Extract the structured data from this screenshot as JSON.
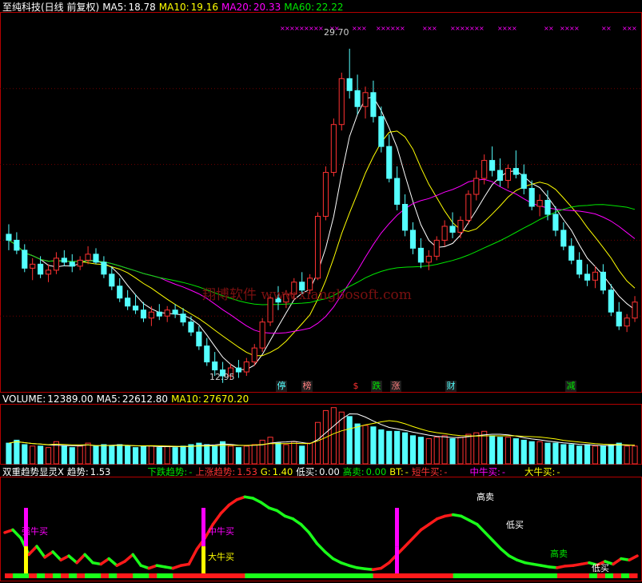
{
  "header": {
    "stock": "至纯科技(日线 前复权)",
    "ma5_label": "MA5:",
    "ma5_value": "18.78",
    "ma10_label": "MA10:",
    "ma10_value": "19.16",
    "ma20_label": "MA20:",
    "ma20_value": "20.33",
    "ma60_label": "MA60:",
    "ma60_value": "22.22"
  },
  "colors": {
    "up": "#ff3232",
    "down": "#54ffff",
    "ma5": "#ffffff",
    "ma10": "#ffff00",
    "ma20": "#ff00ff",
    "ma60": "#00e600",
    "panel_border": "#b40000",
    "grid": "#700000"
  },
  "annotations": {
    "high_label": "29.70",
    "low_label": "12.95",
    "watermark": "翔博软件 www.xiangbosoft.com"
  },
  "event_badges": [
    {
      "text": "停",
      "color": "#54ffff"
    },
    {
      "text": "榜",
      "color": "#ff8080"
    },
    {
      "text": "$",
      "color": "#ff3232"
    },
    {
      "text": "跌",
      "color": "#00e600"
    },
    {
      "text": "涨",
      "color": "#ff8080"
    },
    {
      "text": "财",
      "color": "#54ffff"
    },
    {
      "text": "减",
      "color": "#00e600"
    }
  ],
  "volume_header": {
    "label": "VOLUME:",
    "value": "12389.00",
    "ma5_label": "MA5:",
    "ma5_value": "22612.80",
    "ma10_label": "MA10:",
    "ma10_value": "27670.20"
  },
  "indicator_header": {
    "name": "双重趋势显灵X",
    "trend_label": "趋势:",
    "trend_value": "1.53",
    "down_label": "下跌趋势:",
    "down_value": "-",
    "up_label": "上涨趋势:",
    "up_value": "1.53",
    "g_label": "G:",
    "g_value": "1.40",
    "lowbuy_label": "低买:",
    "lowbuy_value": "0.00",
    "highsell_label": "高卖:",
    "highsell_value": "0.00",
    "bt_label": "BT:",
    "bt_value": "-",
    "short_bull_label": "短牛买:",
    "short_bull_value": "-",
    "mid_bull_label": "中牛买:",
    "mid_bull_value": "-",
    "big_bull_label": "大牛买:",
    "big_bull_value": "-"
  },
  "signal_labels": [
    {
      "text": "高卖",
      "color": "#ffffff"
    },
    {
      "text": "低买",
      "color": "#ffffff"
    },
    {
      "text": "中牛买",
      "color": "#ff00ff"
    },
    {
      "text": "大牛买",
      "color": "#ffff00"
    },
    {
      "text": "强牛买",
      "color": "#ff00ff"
    },
    {
      "text": "高卖",
      "color": "#00e600"
    },
    {
      "text": "低买",
      "color": "#ffffff"
    }
  ],
  "chart_data": {
    "type": "candlestick",
    "candles": [
      [
        20.4,
        20.9,
        19.6,
        20.1
      ],
      [
        20.1,
        20.5,
        19.4,
        19.6
      ],
      [
        19.6,
        19.9,
        18.5,
        18.7
      ],
      [
        18.7,
        19.2,
        18.1,
        18.9
      ],
      [
        18.9,
        19.3,
        18.2,
        18.4
      ],
      [
        18.4,
        18.9,
        18.0,
        18.6
      ],
      [
        18.6,
        19.5,
        18.4,
        19.2
      ],
      [
        19.2,
        19.6,
        18.8,
        19.0
      ],
      [
        19.0,
        19.4,
        18.5,
        18.8
      ],
      [
        18.8,
        19.3,
        18.6,
        19.1
      ],
      [
        19.1,
        19.8,
        18.9,
        19.4
      ],
      [
        19.4,
        19.7,
        18.9,
        19.0
      ],
      [
        19.0,
        19.3,
        18.2,
        18.4
      ],
      [
        18.4,
        18.8,
        17.6,
        17.8
      ],
      [
        17.8,
        18.2,
        17.0,
        17.2
      ],
      [
        17.2,
        17.6,
        16.6,
        16.8
      ],
      [
        16.8,
        17.4,
        16.4,
        16.6
      ],
      [
        16.6,
        17.0,
        16.0,
        16.2
      ],
      [
        16.2,
        16.8,
        15.8,
        16.5
      ],
      [
        16.5,
        16.9,
        16.1,
        16.3
      ],
      [
        16.3,
        16.8,
        16.0,
        16.6
      ],
      [
        16.6,
        16.9,
        16.2,
        16.4
      ],
      [
        16.4,
        16.7,
        15.8,
        16.0
      ],
      [
        16.0,
        16.3,
        15.3,
        15.5
      ],
      [
        15.5,
        15.8,
        14.6,
        14.8
      ],
      [
        14.8,
        15.2,
        13.8,
        14.0
      ],
      [
        14.0,
        14.5,
        13.3,
        13.6
      ],
      [
        13.6,
        14.0,
        12.95,
        13.3
      ],
      [
        13.3,
        13.9,
        13.1,
        13.7
      ],
      [
        13.7,
        14.1,
        13.2,
        13.5
      ],
      [
        13.5,
        14.2,
        13.3,
        14.0
      ],
      [
        14.0,
        14.9,
        13.8,
        14.7
      ],
      [
        14.7,
        16.2,
        14.5,
        16.0
      ],
      [
        16.0,
        17.4,
        15.8,
        17.2
      ],
      [
        17.2,
        17.8,
        16.6,
        17.0
      ],
      [
        17.0,
        17.6,
        16.7,
        17.4
      ],
      [
        17.4,
        18.2,
        17.1,
        18.0
      ],
      [
        18.0,
        18.5,
        17.4,
        17.6
      ],
      [
        17.6,
        18.4,
        17.4,
        18.2
      ],
      [
        18.2,
        21.5,
        18.1,
        21.3
      ],
      [
        21.3,
        23.8,
        21.1,
        23.5
      ],
      [
        23.5,
        26.2,
        23.3,
        25.9
      ],
      [
        25.9,
        28.5,
        25.6,
        28.2
      ],
      [
        28.2,
        29.7,
        27.2,
        27.6
      ],
      [
        27.6,
        28.4,
        26.4,
        26.8
      ],
      [
        26.8,
        27.8,
        26.2,
        27.5
      ],
      [
        27.5,
        28.1,
        26.0,
        26.3
      ],
      [
        26.3,
        26.8,
        24.5,
        24.8
      ],
      [
        24.8,
        25.4,
        23.0,
        23.2
      ],
      [
        23.2,
        23.8,
        21.6,
        21.9
      ],
      [
        21.9,
        22.4,
        20.3,
        20.6
      ],
      [
        20.6,
        21.0,
        19.4,
        19.7
      ],
      [
        19.7,
        20.2,
        18.7,
        19.0
      ],
      [
        19.0,
        19.6,
        18.6,
        19.3
      ],
      [
        19.3,
        20.3,
        19.1,
        20.1
      ],
      [
        20.1,
        21.1,
        19.8,
        20.8
      ],
      [
        20.8,
        21.5,
        20.2,
        20.5
      ],
      [
        20.5,
        21.3,
        20.2,
        21.1
      ],
      [
        21.1,
        22.6,
        20.9,
        22.4
      ],
      [
        22.4,
        23.6,
        22.1,
        23.2
      ],
      [
        23.2,
        24.4,
        22.9,
        24.1
      ],
      [
        24.1,
        24.8,
        23.3,
        23.6
      ],
      [
        23.6,
        24.2,
        22.8,
        23.1
      ],
      [
        23.1,
        23.9,
        22.7,
        23.7
      ],
      [
        23.7,
        24.6,
        23.2,
        23.4
      ],
      [
        23.4,
        23.9,
        22.4,
        22.7
      ],
      [
        22.7,
        23.1,
        21.6,
        21.8
      ],
      [
        21.8,
        22.4,
        21.3,
        22.1
      ],
      [
        22.1,
        22.6,
        21.1,
        21.4
      ],
      [
        21.4,
        21.8,
        20.3,
        20.6
      ],
      [
        20.6,
        21.0,
        19.6,
        19.8
      ],
      [
        19.8,
        20.2,
        18.9,
        19.1
      ],
      [
        19.1,
        19.5,
        18.2,
        18.4
      ],
      [
        18.4,
        18.9,
        17.8,
        18.1
      ],
      [
        18.1,
        18.8,
        17.7,
        18.5
      ],
      [
        18.5,
        18.9,
        17.4,
        17.6
      ],
      [
        17.6,
        17.9,
        16.3,
        16.5
      ],
      [
        16.5,
        17.0,
        15.6,
        15.8
      ],
      [
        15.8,
        16.4,
        15.5,
        16.2
      ],
      [
        16.2,
        17.3,
        16.0,
        17.0
      ]
    ],
    "volume": [
      14,
      16,
      13,
      12,
      12,
      11,
      15,
      12,
      11,
      12,
      14,
      12,
      13,
      12,
      13,
      12,
      11,
      12,
      12,
      11,
      12,
      11,
      12,
      13,
      14,
      13,
      12,
      15,
      12,
      11,
      12,
      13,
      16,
      18,
      14,
      13,
      15,
      12,
      14,
      28,
      36,
      38,
      35,
      32,
      27,
      26,
      25,
      23,
      22,
      22,
      21,
      19,
      18,
      17,
      18,
      19,
      17,
      18,
      20,
      21,
      22,
      19,
      18,
      18,
      17,
      16,
      15,
      15,
      14,
      14,
      13,
      13,
      12,
      13,
      12,
      12,
      13,
      14,
      12,
      12
    ],
    "ylim": [
      12.5,
      31.5
    ],
    "volume_max": 40,
    "oscillator": [
      1.4,
      1.5,
      1.2,
      0.6,
      0.9,
      0.5,
      0.7,
      0.4,
      0.55,
      0.3,
      0.6,
      0.3,
      0.25,
      0.45,
      0.2,
      0.35,
      0.6,
      0.2,
      0.1,
      0.2,
      0.15,
      0.1,
      0.2,
      0.25,
      0.8,
      1.2,
      1.7,
      2.1,
      2.4,
      2.6,
      2.7,
      2.65,
      2.5,
      2.3,
      2.2,
      2.0,
      1.9,
      1.7,
      1.4,
      1.0,
      0.7,
      0.45,
      0.3,
      0.2,
      0.12,
      0.08,
      0.05,
      0.1,
      0.3,
      0.6,
      0.9,
      1.2,
      1.5,
      1.7,
      1.9,
      2.0,
      2.05,
      2.0,
      1.85,
      1.7,
      1.4,
      1.1,
      0.8,
      0.55,
      0.4,
      0.3,
      0.25,
      0.2,
      0.15,
      0.12,
      0.18,
      0.2,
      0.25,
      0.3,
      0.22,
      0.35,
      0.25,
      0.45,
      0.4,
      0.55
    ],
    "oscillator_ylim": [
      0,
      3
    ]
  }
}
